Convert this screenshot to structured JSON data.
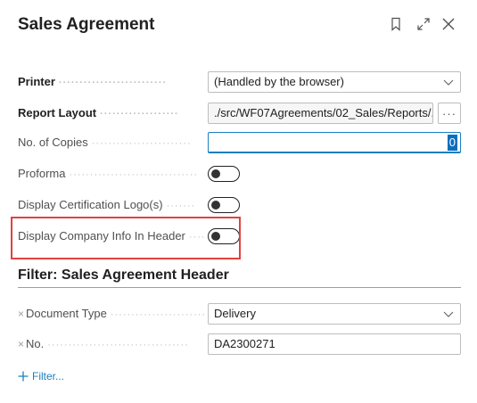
{
  "dialog": {
    "title": "Sales Agreement",
    "icons": [
      "bookmark-icon",
      "expand-icon",
      "close-icon"
    ]
  },
  "fields": {
    "printer": {
      "label": "Printer",
      "value": "(Handled by the browser)"
    },
    "report_layout": {
      "label": "Report Layout",
      "value": "./src/WF07Agreements/02_Sales/Reports/...",
      "button": "···"
    },
    "copies": {
      "label": "No. of Copies",
      "value": "0"
    },
    "proforma": {
      "label": "Proforma",
      "checked": false
    },
    "cert_logo": {
      "label": "Display Certification Logo(s)",
      "checked": false
    },
    "company_info": {
      "label": "Display Company Info In Header",
      "checked": false
    }
  },
  "filter": {
    "title": "Filter: Sales Agreement Header",
    "document_type": {
      "remove": "×",
      "label": "Document Type",
      "value": "Delivery"
    },
    "no": {
      "remove": "×",
      "label": "No.",
      "value": "DA2300271"
    },
    "add_label": "Filter..."
  },
  "colors": {
    "accent": "#1a7fbf",
    "highlight": "#e0433e"
  }
}
